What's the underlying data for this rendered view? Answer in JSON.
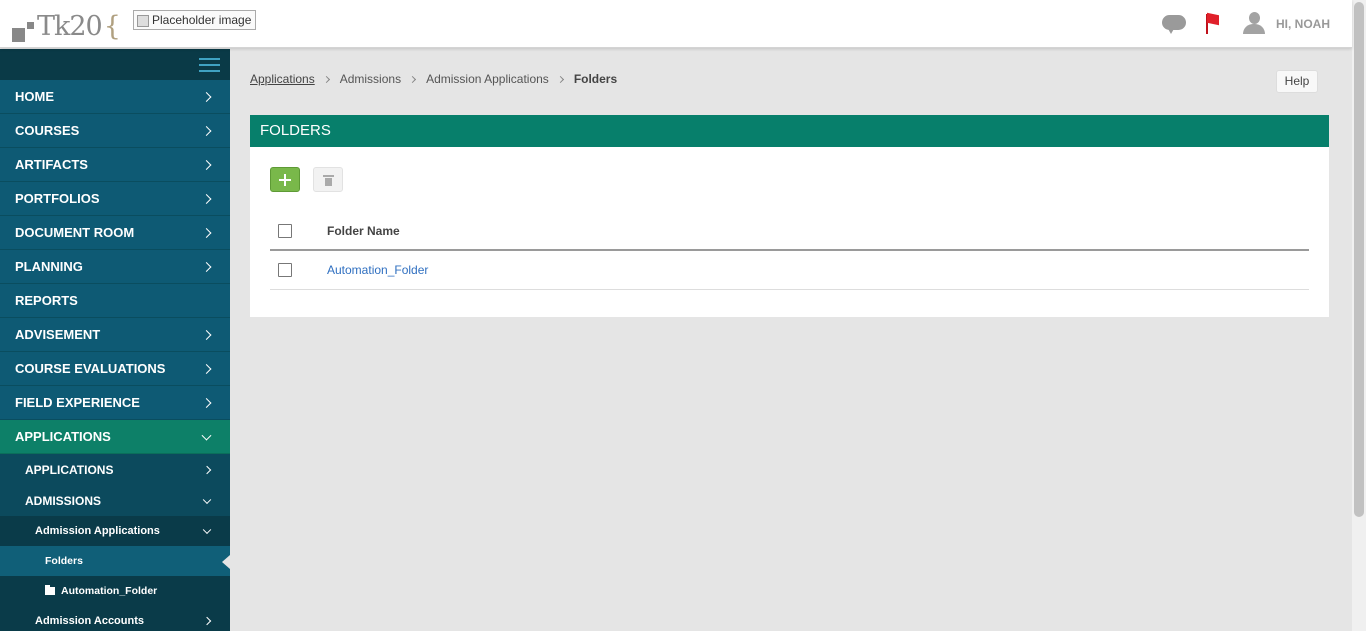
{
  "header": {
    "logo_text": "Tk20",
    "logo_brace": "{",
    "placeholder_alt": "Placeholder image",
    "icons": [
      "chat-icon",
      "flag-icon",
      "user-icon"
    ],
    "user_greeting": "HI, NOAH"
  },
  "sidebar": {
    "items": [
      {
        "label": "HOME"
      },
      {
        "label": "COURSES"
      },
      {
        "label": "ARTIFACTS"
      },
      {
        "label": "PORTFOLIOS"
      },
      {
        "label": "DOCUMENT ROOM"
      },
      {
        "label": "PLANNING"
      },
      {
        "label": "REPORTS"
      },
      {
        "label": "ADVISEMENT"
      },
      {
        "label": "COURSE EVALUATIONS"
      },
      {
        "label": "FIELD EXPERIENCE"
      },
      {
        "label": "APPLICATIONS"
      }
    ],
    "sub": {
      "applications": "APPLICATIONS",
      "admissions": "ADMISSIONS",
      "admission_applications": "Admission Applications",
      "folders": "Folders",
      "automation_folder": "Automation_Folder",
      "admission_accounts": "Admission Accounts"
    }
  },
  "breadcrumb": {
    "items": [
      "Applications",
      "Admissions",
      "Admission Applications",
      "Folders"
    ]
  },
  "help_label": "Help",
  "panel": {
    "title": "FOLDERS",
    "table": {
      "columns": [
        "Folder Name"
      ],
      "rows": [
        [
          "Automation_Folder"
        ]
      ]
    }
  },
  "colors": {
    "accent": "#077f6b",
    "sidebar": "#0e5a74",
    "add_button": "#79b84a",
    "link": "#2f6fc0"
  }
}
